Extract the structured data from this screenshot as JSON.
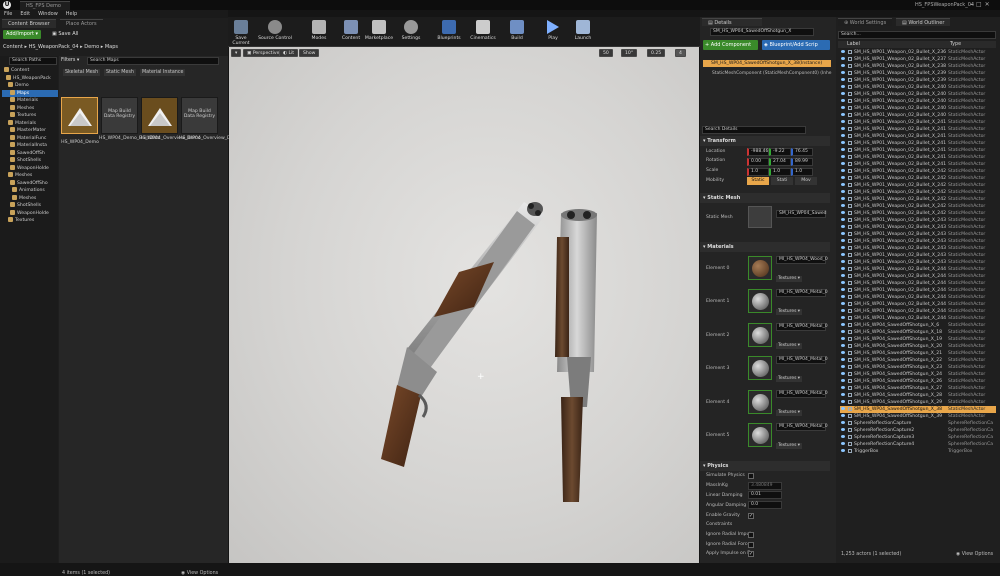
{
  "window": {
    "title_tab": "HS_FPS Demo",
    "project_tab": "HS_FPSWeaponPack_04"
  },
  "menu": [
    "File",
    "Edit",
    "Window",
    "Help"
  ],
  "content_browser": {
    "tab": "Content Browser",
    "tab2": "Place Actors",
    "add_import": "Add/Import",
    "save_all": "Save All",
    "path": [
      "Content",
      "HS_WeaponPack_04",
      "Demo",
      "Maps"
    ],
    "search_paths": "Search Paths",
    "filters": "Filters",
    "search_maps": "Search Maps",
    "tree": [
      "Content",
      "HS_WeaponPack",
      "Demo",
      "Maps",
      "Materials",
      "Meshes",
      "Textures",
      "Materials",
      "MasterMater",
      "MaterialFunc",
      "MaterialInsta",
      "SawedOffSh",
      "ShotShells",
      "WeaponHolde",
      "Meshes",
      "SawedOffSho",
      "Animations",
      "Meshes",
      "ShotShells",
      "WeaponHolde",
      "Textures"
    ],
    "filter_tabs": [
      "Skeletal Mesh",
      "Static Mesh",
      "Material Instance"
    ],
    "assets": [
      "HS_WP04_Demo",
      "HS_WP04_Demo_BuiltData",
      "HS_WP04_Overview_Demo",
      "HS_WP04_Overview_Demo_BuiltData"
    ],
    "tile_captions": [
      "",
      "Map Build Data Registry",
      "",
      "Map Build Data Registry"
    ],
    "count": "4 items (1 selected)",
    "view_options": "View Options"
  },
  "toolbar": [
    "Save Current",
    "Source Control",
    "Modes",
    "Content",
    "Marketplace",
    "Settings",
    "Blueprints",
    "Cinematics",
    "Build",
    "Play",
    "Launch"
  ],
  "viewport": {
    "perspective": "Perspective",
    "lit": "Lit",
    "show": "Show",
    "grid": "50",
    "angle": "10°",
    "scale": "0.25",
    "cam": "4"
  },
  "details": {
    "tab": "Details",
    "actor": "SM_HS_WP04_SawedOffShotgun_X",
    "add_component": "+ Add Component",
    "blueprint": "Blueprint/Add Scrip",
    "selected": "SM_HS_WP04_SawedOffShotgun_X_38(Instance)",
    "component": "StaticMeshComponent (StaticMeshComponent0) (Inhe",
    "search": "Search Details",
    "transform": "Transform",
    "location": "Location",
    "rotation": "Rotation",
    "scale": "Scale",
    "mobility": "Mobility",
    "loc": [
      "-988.46",
      "-9.22",
      "76.45"
    ],
    "rot": [
      "0.00",
      "27.04",
      "89.99"
    ],
    "scl": [
      "1.0",
      "1.0",
      "1.0"
    ],
    "mob": [
      "Static",
      "Stati",
      "Mov"
    ],
    "static_mesh_hdr": "Static Mesh",
    "static_mesh_label": "Static Mesh",
    "mesh_name": "SM_HS_WP04_Sawed",
    "materials_hdr": "Materials",
    "elements": [
      "Element 0",
      "Element 1",
      "Element 2",
      "Element 3",
      "Element 4",
      "Element 5"
    ],
    "mat_names": [
      "MI_HS_WP04_Wood_0",
      "MI_HS_WP04_Metal_0",
      "MI_HS_WP04_Metal_0",
      "MI_HS_WP04_Metal_0",
      "MI_HS_WP04_Metal_0",
      "MI_HS_WP04_Metal_0"
    ],
    "textures": "Textures",
    "physics_hdr": "Physics",
    "phys": [
      "Simulate Physics",
      "MassInKg",
      "Linear Damping",
      "Angular Damping",
      "Enable Gravity",
      "Constraints",
      "Ignore Radial Impul",
      "Ignore Radial Force",
      "Apply Impulse on D"
    ],
    "mass": "3.480849",
    "lin": "0.01",
    "ang": "0.0"
  },
  "outliner": {
    "tab1": "World Settings",
    "tab2": "World Outliner",
    "search": "Search...",
    "col_label": "Label",
    "col_type": "Type",
    "type_static": "StaticMeshActor",
    "type_sphere": "SphereReflectionCa",
    "type_trigger": "TriggerBox",
    "rows": [
      "SM_HS_WP01_Weapon_02_Bullet_X_236",
      "SM_HS_WP01_Weapon_02_Bullet_X_237",
      "SM_HS_WP01_Weapon_02_Bullet_X_238",
      "SM_HS_WP01_Weapon_02_Bullet_X_239",
      "SM_HS_WP01_Weapon_02_Bullet_X_239",
      "SM_HS_WP01_Weapon_02_Bullet_X_240",
      "SM_HS_WP01_Weapon_02_Bullet_X_240",
      "SM_HS_WP01_Weapon_02_Bullet_X_240",
      "SM_HS_WP01_Weapon_02_Bullet_X_240",
      "SM_HS_WP01_Weapon_02_Bullet_X_240",
      "SM_HS_WP01_Weapon_02_Bullet_X_241",
      "SM_HS_WP01_Weapon_02_Bullet_X_241",
      "SM_HS_WP01_Weapon_02_Bullet_X_241",
      "SM_HS_WP01_Weapon_02_Bullet_X_241",
      "SM_HS_WP01_Weapon_02_Bullet_X_241",
      "SM_HS_WP01_Weapon_02_Bullet_X_241",
      "SM_HS_WP01_Weapon_02_Bullet_X_241",
      "SM_HS_WP01_Weapon_02_Bullet_X_242",
      "SM_HS_WP01_Weapon_02_Bullet_X_242",
      "SM_HS_WP01_Weapon_02_Bullet_X_242",
      "SM_HS_WP01_Weapon_02_Bullet_X_242",
      "SM_HS_WP01_Weapon_02_Bullet_X_242",
      "SM_HS_WP01_Weapon_02_Bullet_X_242",
      "SM_HS_WP01_Weapon_02_Bullet_X_242",
      "SM_HS_WP01_Weapon_02_Bullet_X_243",
      "SM_HS_WP01_Weapon_02_Bullet_X_243",
      "SM_HS_WP01_Weapon_02_Bullet_X_243",
      "SM_HS_WP01_Weapon_02_Bullet_X_243",
      "SM_HS_WP01_Weapon_02_Bullet_X_243",
      "SM_HS_WP01_Weapon_02_Bullet_X_243",
      "SM_HS_WP01_Weapon_02_Bullet_X_243",
      "SM_HS_WP01_Weapon_02_Bullet_X_244",
      "SM_HS_WP01_Weapon_02_Bullet_X_244",
      "SM_HS_WP01_Weapon_02_Bullet_X_244",
      "SM_HS_WP01_Weapon_02_Bullet_X_244",
      "SM_HS_WP01_Weapon_02_Bullet_X_244",
      "SM_HS_WP01_Weapon_02_Bullet_X_244",
      "SM_HS_WP01_Weapon_02_Bullet_X_244",
      "SM_HS_WP01_Weapon_02_Bullet_X_244",
      "SM_HS_WP04_SawedOffShotgun_X_6",
      "SM_HS_WP04_SawedOffShotgun_X_18",
      "SM_HS_WP04_SawedOffShotgun_X_19",
      "SM_HS_WP04_SawedOffShotgun_X_20",
      "SM_HS_WP04_SawedOffShotgun_X_21",
      "SM_HS_WP04_SawedOffShotgun_X_22",
      "SM_HS_WP04_SawedOffShotgun_X_23",
      "SM_HS_WP04_SawedOffShotgun_X_24",
      "SM_HS_WP04_SawedOffShotgun_X_26",
      "SM_HS_WP04_SawedOffShotgun_X_27",
      "SM_HS_WP04_SawedOffShotgun_X_28",
      "SM_HS_WP04_SawedOffShotgun_X_29",
      "SM_HS_WP04_SawedOffShotgun_X_38",
      "SM_HS_WP04_SawedOffShotgun_X_39",
      "SphereReflectionCapture",
      "SphereReflectionCapture2",
      "SphereReflectionCapture3",
      "SphereReflectionCapture4",
      "TriggerBox"
    ],
    "count": "1,253 actors (1 selected)",
    "view_options": "View Options"
  },
  "colors": {
    "accent": "#2b6bb3",
    "selected": "#e8a64a",
    "bg": "#232323"
  }
}
